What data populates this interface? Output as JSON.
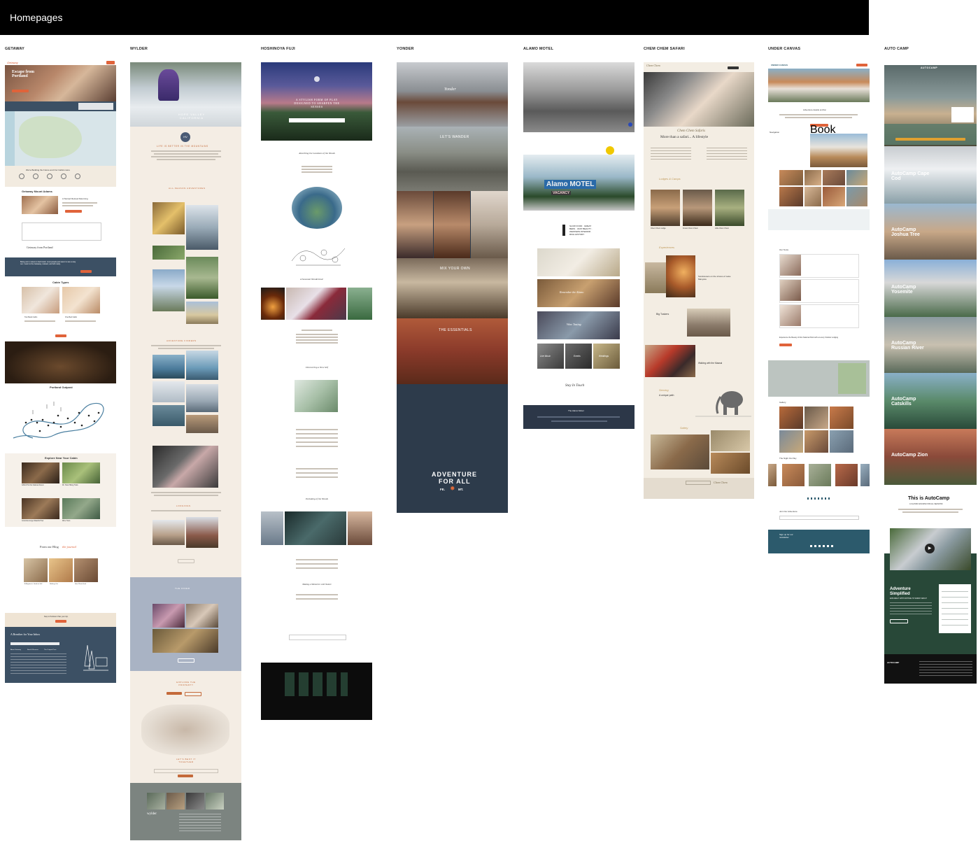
{
  "board": {
    "title": "Homepages",
    "columns": [
      {
        "key": "getaway",
        "label": "GETAWAY"
      },
      {
        "key": "wylder",
        "label": "WYLDER"
      },
      {
        "key": "hoshinoya",
        "label": "HOSHINOYA FUJI"
      },
      {
        "key": "yonder",
        "label": "YONDER"
      },
      {
        "key": "alamo",
        "label": "ALAMO MOTEL"
      },
      {
        "key": "chemchem",
        "label": "CHEM CHEM SAFARI"
      },
      {
        "key": "undercanvas",
        "label": "UNDER CANVAS"
      },
      {
        "key": "autocamp",
        "label": "AUTO CAMP"
      }
    ]
  },
  "getaway": {
    "logo": "Getaway",
    "hero_title": "Escape from Portland",
    "hero_button": "Find a Cabin",
    "map_intro": "We're Building the Future and Our Cabins Here",
    "outpost_title": "Getaway Mount Adams",
    "outpost_sub": "A Storied Retreat Returning",
    "outpost_button": "Book Now",
    "tagline_title": "Getaway from Portland",
    "quote": "Being out in nature is hard work; most people just seem to see a way out. I went to the Getaway, relaxed, and left ready.",
    "quote_button": "Book Now",
    "cabin_types_title": "Cabin Types",
    "cabin_a": "Two Beds Cabin",
    "cabin_b": "One Bed Cabin",
    "outpost_map_title": "Portland Outpost",
    "explore_title": "Explore Near Your Cabin",
    "explore_a": "Gifford Pinchot National Forest",
    "explore_b": "Mt. Hood Hiking Trails",
    "explore_c": "Columbia Gorge Waterfall Tour",
    "explore_d": "Wine Tours",
    "blog_title": "From our Blog",
    "blog_script": "the journal",
    "blog_a": "A Beginner's Guide to Fall",
    "blog_b": "Nothing Out",
    "blog_c": "How Plants Heal",
    "promo": "Stop in Portland. Plan your trip.",
    "promo_button": "Book Now",
    "footer_title": "A Breather for Your Inbox",
    "footer_col_a": "About Getaway",
    "footer_col_b": "Book & Reserve",
    "footer_col_c": "The Outpost Pass"
  },
  "wylder": {
    "hero_text": "HOPE VALLEY CALIFORNIA",
    "badge": "HV",
    "intro_title": "LIFE IS BETTER IN THE MOUNTAINS",
    "adventure_title": "ALL-SEASON ADVENTURES",
    "gallery_title": "ADVENTURE FINDERS",
    "lodging_title": "LODGINGS",
    "dining_title": "THE DINER",
    "explore_title": "EXPLORE THE PROPERTY",
    "stay_title": "LET'S BEST IT TOGETHER",
    "footer_logo": "wylder"
  },
  "hoshinoya": {
    "hero_title": "A STYLISH FORM OF PLAY DESIGNED TO SHARPEN THE SENSES",
    "section_a": "Absorbing the Goodness of the Woods",
    "section_b": "A Seasonal Wonderland",
    "section_c": "Discovering a New Self",
    "section_d": "Partaking of the Woods",
    "section_e": "Making a Memories with Nature"
  },
  "yonder": {
    "logo": "Yonder",
    "band_a": "LET'S WANDER",
    "band_b": "MIX YOUR OWN",
    "band_c": "THE ESSENTIALS",
    "footer_line1": "ADVENTURE",
    "footer_line2": "FOR ALL",
    "footer_left": "FE.",
    "footer_right": "MT."
  },
  "alamo": {
    "sign": "Alamo MOTEL",
    "vacancy": "VACANCY",
    "features": "SLOW FOOD · GREAT BEDS · VAST BEAUTY · WESTERN INTERIOR · RICH HISTORY",
    "card_a": "Remember the Alamo",
    "card_b": "Wine Tasting",
    "card_c": "Live Music",
    "card_d": "Events",
    "card_e": "Weddings",
    "contact": "Stay In Touch",
    "footer_logo": "The Alamo Motel"
  },
  "chemchem": {
    "logo": "Chem Chem",
    "script": "Chem Chem Safaris",
    "tagline": "More than a safari... A lifestyle",
    "lodges_title": "Lodges & Camps",
    "lodge_a": "Chem Chem Lodge",
    "lodge_b": "Forest Chem Chem",
    "lodge_c": "Little Chem Chem",
    "experiences": "Experiences",
    "exp_a": "Sundowners on the shores of Lake Manyara",
    "exp_b": "Big Tuskers",
    "exp_c": "Walking with the Maasai",
    "serving": "Serving",
    "serving_sub": "A unique path",
    "safety": "Safety",
    "footer_logo": "Chem Chem"
  },
  "undercanvas": {
    "logo": "UNDER CANVAS",
    "button": "Book Now",
    "headline": "Adventure Awaits at Zion",
    "nav_title": "Navigation",
    "tents_title": "Our Tents",
    "experience": "Experience the Beauty of Zion National Park with a Luxury Outdoor Lodging",
    "gallery": "Gallery",
    "nearby": "The Night Out Sky",
    "newsletter": "Join Our Adventure",
    "footer_title": "Sign up for our newsletter"
  },
  "autocamp": {
    "logo": "AUTOCAMP",
    "locations": [
      "AutoCamp Cape Cod",
      "AutoCamp Joshua Tree",
      "AutoCamp Yosemite",
      "AutoCamp Russian River",
      "AutoCamp Catskills",
      "AutoCamp Zion"
    ],
    "intro_title": "This is AutoCamp",
    "intro_sub": "A CLASSIC ESCAPE FOR ALL SEASONS",
    "simplified": "Adventure Simplified",
    "simplified_sub": "EXPLORE IT WITH NOTHING TO WORRY ABOUT",
    "footer_logo": "AUTOCAMP"
  },
  "colors": {
    "topbar": "#000000",
    "getaway_accent": "#e0633a",
    "getaway_navy": "#3c5064",
    "wylder_cream": "#f4ede4",
    "yonder_navy": "#2d3b4b",
    "alamo_navy": "#2c3748",
    "chemchem_beige": "#f3ede3",
    "undercanvas_teal": "#2c5a6c",
    "autocamp_green": "#284838"
  }
}
